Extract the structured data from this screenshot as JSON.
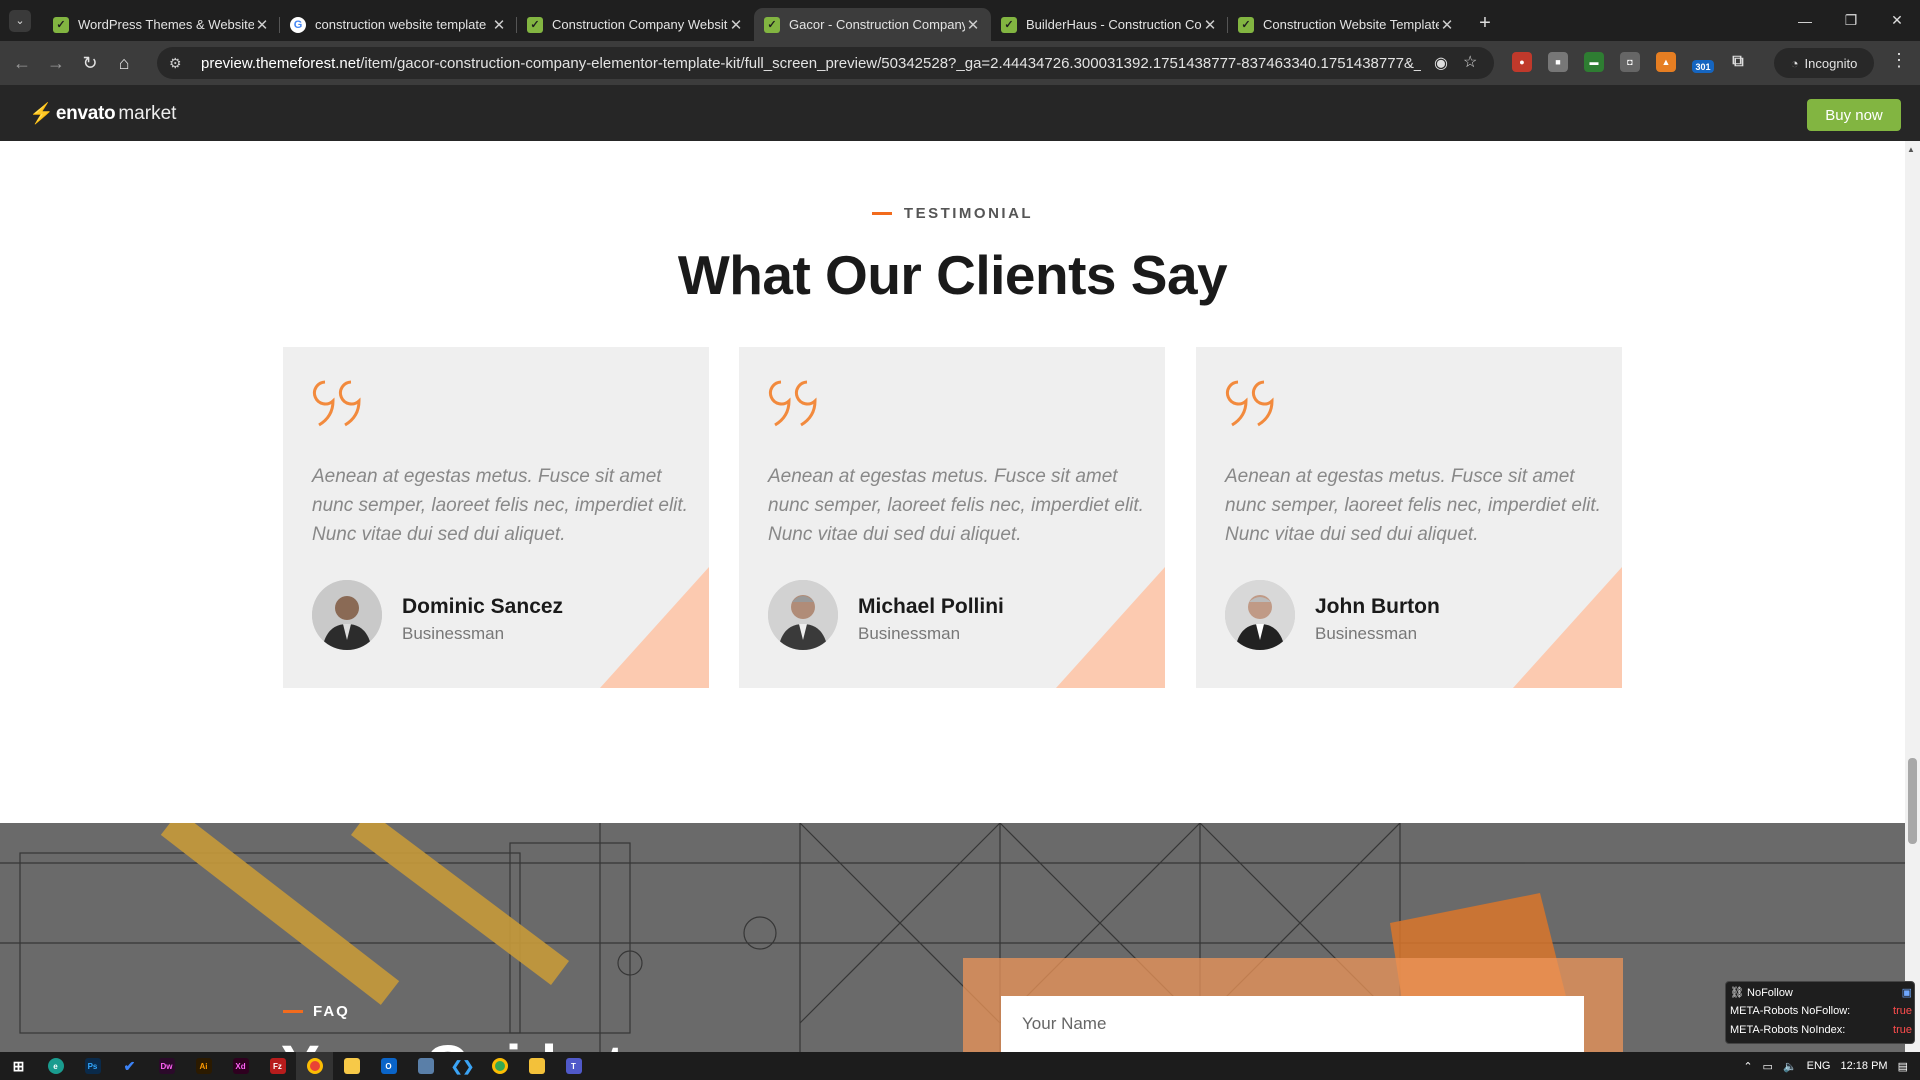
{
  "browser": {
    "tabs": [
      {
        "title": "WordPress Themes & Website Templates",
        "favicon": "envato-icon",
        "active": false
      },
      {
        "title": "construction website template",
        "favicon": "google-icon",
        "active": false
      },
      {
        "title": "Construction Company Website Templates",
        "favicon": "envato-icon",
        "active": false
      },
      {
        "title": "Gacor - Construction Company Elementor",
        "favicon": "envato-icon",
        "active": true
      },
      {
        "title": "BuilderHaus - Construction Company",
        "favicon": "envato-icon",
        "active": false
      },
      {
        "title": "Construction Website Templates",
        "favicon": "envato-icon",
        "active": false
      }
    ],
    "url_domain": "preview.themeforest.net",
    "url_path": "/item/gacor-construction-company-elementor-template-kit/full_screen_preview/50342528?_ga=2.44434726.300031392.1751438777-837463340.1751438777&_gac=1.23822...",
    "incognito_label": "Incognito",
    "ext_badge": "301"
  },
  "envato": {
    "brand": "envato",
    "brand_suffix": "market",
    "buy_label": "Buy now",
    "accent": "#82b541"
  },
  "testimonials": {
    "eyebrow": "TESTIMONIAL",
    "heading": "What Our Clients Say",
    "accent": "#f26b1d",
    "items": [
      {
        "quote": "Aenean at egestas metus. Fusce sit amet nunc semper, laoreet felis nec, imperdiet elit. Nunc vitae dui sed dui aliquet.",
        "name": "Dominic Sancez",
        "role": "Businessman"
      },
      {
        "quote": "Aenean at egestas metus. Fusce sit amet nunc semper, laoreet felis nec, imperdiet elit. Nunc vitae dui sed dui aliquet.",
        "name": "Michael Pollini",
        "role": "Businessman"
      },
      {
        "quote": "Aenean at egestas metus. Fusce sit amet nunc semper, laoreet felis nec, imperdiet elit. Nunc vitae dui sed dui aliquet.",
        "name": "John Burton",
        "role": "Businessman"
      }
    ]
  },
  "faq": {
    "eyebrow": "FAQ",
    "heading": "Your Guide to",
    "name_placeholder": "Your Name"
  },
  "seo_popup": {
    "title": "NoFollow",
    "rows": [
      {
        "label": "META-Robots NoFollow:",
        "value": "true"
      },
      {
        "label": "META-Robots NoIndex:",
        "value": "true"
      }
    ]
  },
  "taskbar": {
    "lang": "ENG",
    "time": "12:18 PM"
  }
}
